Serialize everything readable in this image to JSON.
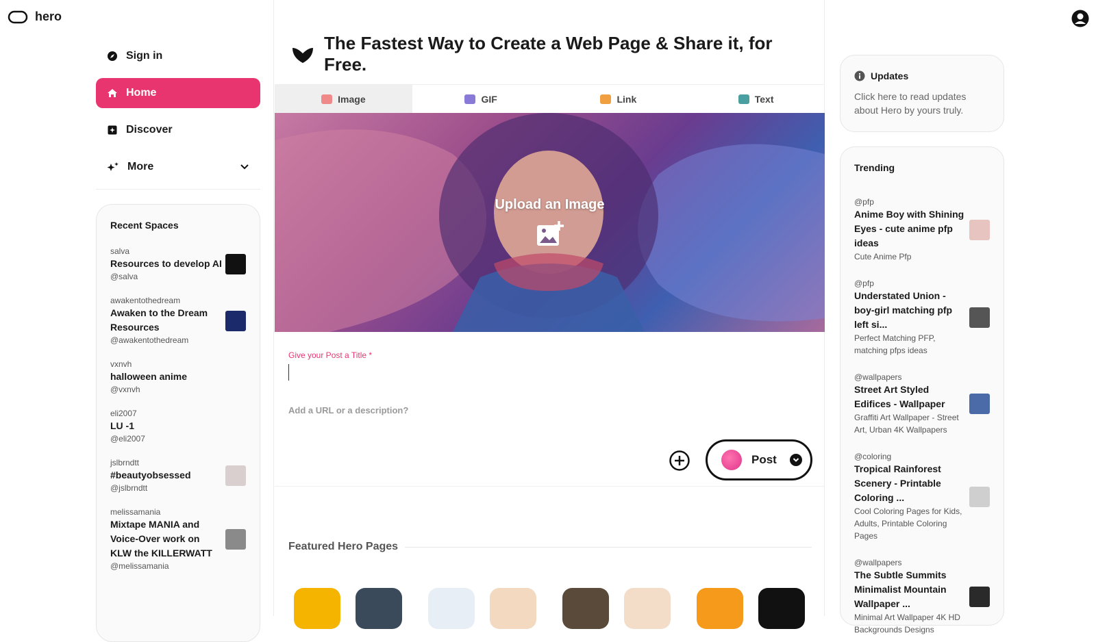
{
  "app": {
    "logo_text": "hero"
  },
  "nav": {
    "items": [
      {
        "label": "Sign in",
        "icon": "compass-icon",
        "active": false
      },
      {
        "label": "Home",
        "icon": "home-icon",
        "active": true
      },
      {
        "label": "Discover",
        "icon": "discover-icon",
        "active": false
      },
      {
        "label": "More",
        "icon": "sparkle-icon",
        "active": false
      }
    ]
  },
  "recent": {
    "title": "Recent Spaces",
    "items": [
      {
        "owner": "salva",
        "name": "Resources to develop AI",
        "handle": "@salva",
        "thumb_color": "#111111"
      },
      {
        "owner": "awakentothedream",
        "name": "Awaken to the Dream Resources",
        "handle": "@awakentothedream",
        "thumb_color": "#1b2a6b"
      },
      {
        "owner": "vxnvh",
        "name": "halloween anime",
        "handle": "@vxnvh",
        "thumb_color": ""
      },
      {
        "owner": "eli2007",
        "name": "LU -1",
        "handle": "@eli2007",
        "thumb_color": ""
      },
      {
        "owner": "jslbrndtt",
        "name": "#beautyobsessed",
        "handle": "@jslbrndtt",
        "thumb_color": "#d9cfcf"
      },
      {
        "owner": "melissamania",
        "name": "Mixtape MANIA and Voice-Over work on KLW the KILLERWATT",
        "handle": "@melissamania",
        "thumb_color": "#8a8a8a"
      }
    ]
  },
  "main": {
    "heading": "The Fastest Way to Create a Web Page & Share it, for Free.",
    "tabs": [
      {
        "label": "Image",
        "active": true,
        "color": "#f08a8a"
      },
      {
        "label": "GIF",
        "active": false,
        "color": "#8a7ad8"
      },
      {
        "label": "Link",
        "active": false,
        "color": "#f0a040"
      },
      {
        "label": "Text",
        "active": false,
        "color": "#4aa0a0"
      }
    ],
    "upload_label": "Upload an Image",
    "title_label": "Give your Post a Title *",
    "title_value": "",
    "desc_placeholder": "Add a URL or a description?",
    "post_label": "Post",
    "featured_title": "Featured Hero Pages",
    "featured_colors": [
      "#f4b400",
      "#3a4a5a",
      "#e8eef5",
      "#f2d9c0",
      "#5a4a3a",
      "#f3dcc8",
      "#f59a1a",
      "#111111"
    ]
  },
  "updates": {
    "title": "Updates",
    "text": "Click here to read updates about Hero by yours truly."
  },
  "trending": {
    "title": "Trending",
    "items": [
      {
        "tag": "@pfp",
        "title": "Anime Boy with Shining Eyes - cute anime pfp ideas",
        "sub": "Cute Anime Pfp",
        "thumb_color": "#e7c4c0"
      },
      {
        "tag": "@pfp",
        "title": "Understated Union - boy-girl matching pfp left si...",
        "sub": "Perfect Matching PFP, matching pfps ideas",
        "thumb_color": "#555555"
      },
      {
        "tag": "@wallpapers",
        "title": "Street Art Styled Edifices - Wallpaper",
        "sub": "Graffiti Art Wallpaper - Street Art, Urban 4K Wallpapers",
        "thumb_color": "#4a6aa8"
      },
      {
        "tag": "@coloring",
        "title": "Tropical Rainforest Scenery - Printable Coloring ...",
        "sub": "Cool Coloring Pages for Kids, Adults, Printable Coloring Pages",
        "thumb_color": "#cfcfcf"
      },
      {
        "tag": "@wallpapers",
        "title": "The Subtle Summits Minimalist Mountain Wallpaper ...",
        "sub": "Minimal Art Wallpaper 4K HD Backgrounds Designs",
        "thumb_color": "#2a2a2a"
      }
    ]
  }
}
